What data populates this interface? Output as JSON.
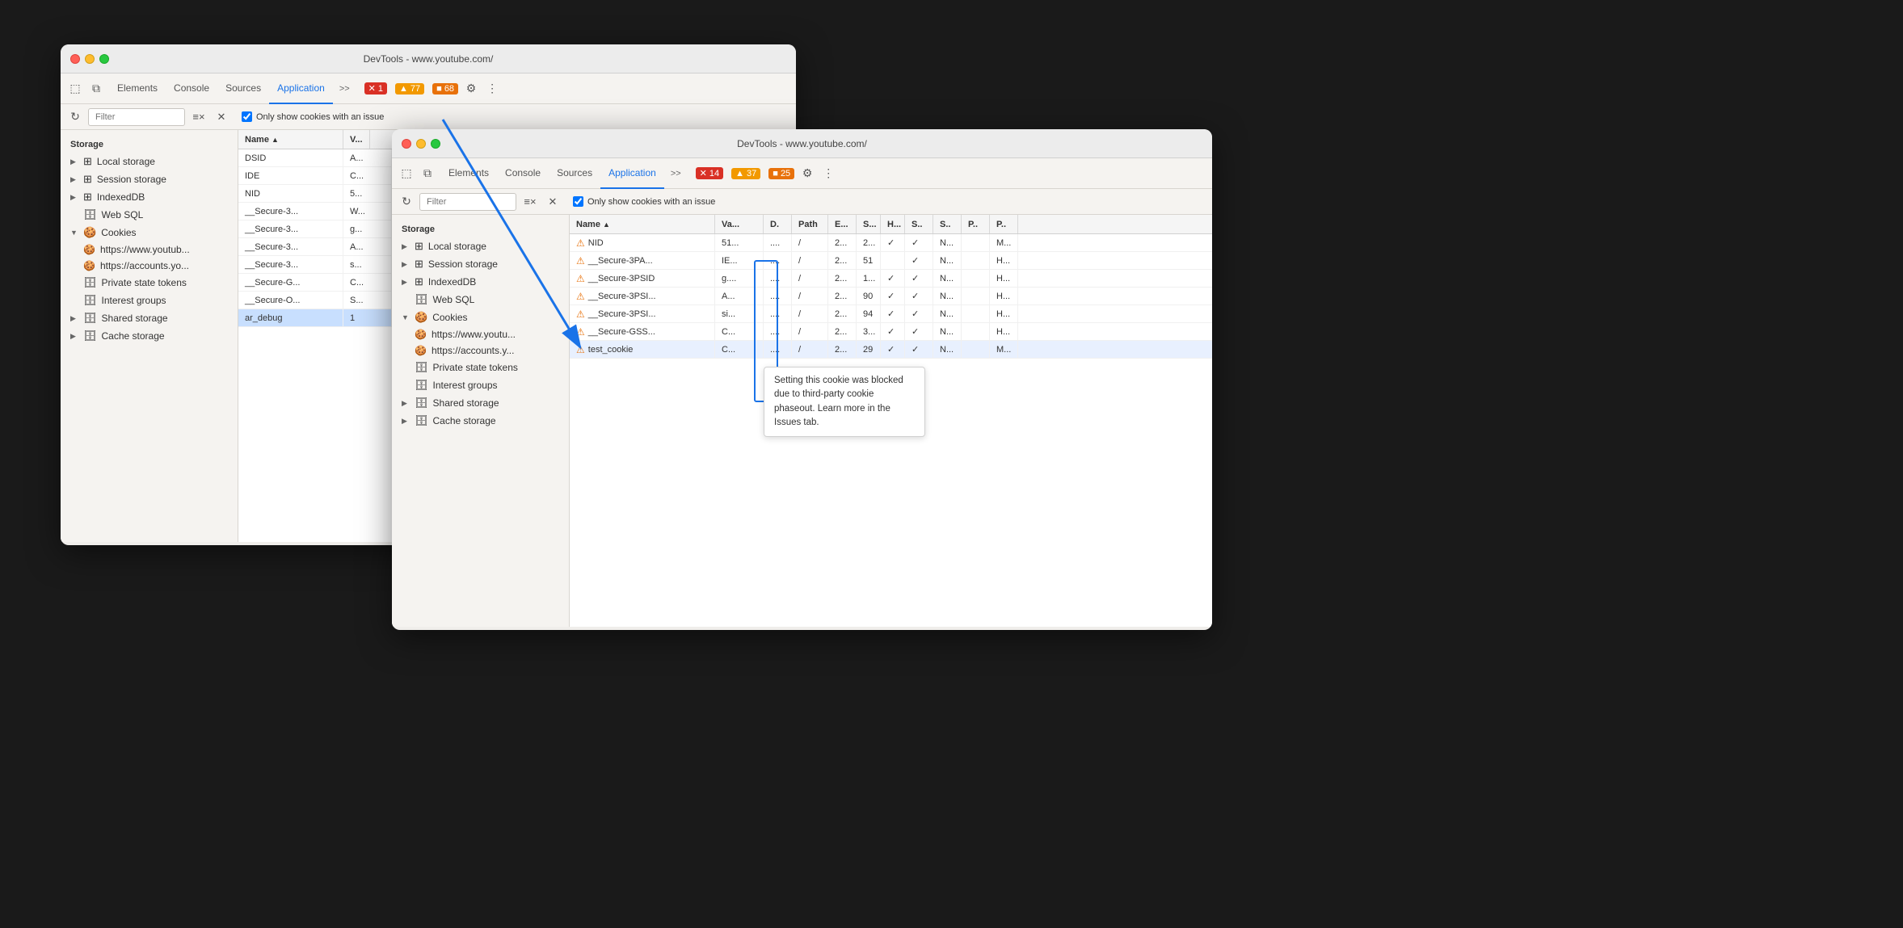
{
  "window_back": {
    "title": "DevTools - www.youtube.com/",
    "tabs": [
      "Elements",
      "Console",
      "Sources",
      "Application"
    ],
    "active_tab": "Application",
    "badges": [
      {
        "type": "error",
        "icon": "✕",
        "count": "1"
      },
      {
        "type": "warn",
        "icon": "▲",
        "count": "77"
      },
      {
        "type": "info",
        "icon": "■",
        "count": "68"
      }
    ],
    "filter_placeholder": "Filter",
    "filter_btn": "≡×",
    "checkbox_label": "Only show cookies with an issue",
    "sidebar": {
      "section": "Storage",
      "items": [
        {
          "label": "Local storage",
          "icon": "⊞",
          "arrow": "▶",
          "indent": 0
        },
        {
          "label": "Session storage",
          "icon": "⊞",
          "arrow": "▶",
          "indent": 0
        },
        {
          "label": "IndexedDB",
          "icon": "⊞",
          "arrow": "▶",
          "indent": 0
        },
        {
          "label": "Web SQL",
          "icon": "🗄",
          "arrow": "",
          "indent": 0
        },
        {
          "label": "Cookies",
          "icon": "🍪",
          "arrow": "▼",
          "indent": 0
        },
        {
          "label": "https://www.youtub...",
          "icon": "🍪",
          "arrow": "",
          "indent": 1
        },
        {
          "label": "https://accounts.yo...",
          "icon": "🍪",
          "arrow": "",
          "indent": 1
        },
        {
          "label": "Private state tokens",
          "icon": "🗄",
          "arrow": "",
          "indent": 0
        },
        {
          "label": "Interest groups",
          "icon": "🗄",
          "arrow": "",
          "indent": 0
        },
        {
          "label": "Shared storage",
          "icon": "🗄",
          "arrow": "▶",
          "indent": 0
        },
        {
          "label": "Cache storage",
          "icon": "🗄",
          "arrow": "▶",
          "indent": 0
        }
      ]
    },
    "table_headers": [
      "Name",
      "V..."
    ],
    "table_rows": [
      {
        "name": "DSID",
        "value": "A...",
        "selected": false
      },
      {
        "name": "IDE",
        "value": "C...",
        "selected": false
      },
      {
        "name": "NID",
        "value": "5...",
        "selected": false
      },
      {
        "name": "__Secure-3...",
        "value": "W...",
        "selected": false
      },
      {
        "name": "__Secure-3...",
        "value": "g...",
        "selected": false
      },
      {
        "name": "__Secure-3...",
        "value": "A...",
        "selected": false
      },
      {
        "name": "__Secure-3...",
        "value": "s...",
        "selected": false
      },
      {
        "name": "__Secure-G...",
        "value": "C...",
        "selected": false
      },
      {
        "name": "__Secure-O...",
        "value": "S...",
        "selected": false
      },
      {
        "name": "ar_debug",
        "value": "1",
        "selected": true
      }
    ]
  },
  "window_front": {
    "title": "DevTools - www.youtube.com/",
    "tabs": [
      "Elements",
      "Console",
      "Sources",
      "Application"
    ],
    "active_tab": "Application",
    "badges": [
      {
        "type": "error",
        "icon": "✕",
        "count": "14"
      },
      {
        "type": "warn",
        "icon": "▲",
        "count": "37"
      },
      {
        "type": "info",
        "icon": "■",
        "count": "25"
      }
    ],
    "filter_placeholder": "Filter",
    "checkbox_label": "Only show cookies with an issue",
    "sidebar": {
      "section": "Storage",
      "items": [
        {
          "label": "Local storage",
          "icon": "⊞",
          "arrow": "▶",
          "indent": 0
        },
        {
          "label": "Session storage",
          "icon": "⊞",
          "arrow": "▶",
          "indent": 0
        },
        {
          "label": "IndexedDB",
          "icon": "⊞",
          "arrow": "▶",
          "indent": 0
        },
        {
          "label": "Web SQL",
          "icon": "🗄",
          "arrow": "",
          "indent": 0
        },
        {
          "label": "Cookies",
          "icon": "🍪",
          "arrow": "▼",
          "indent": 0
        },
        {
          "label": "https://www.youtu...",
          "icon": "🍪",
          "arrow": "",
          "indent": 1
        },
        {
          "label": "https://accounts.y...",
          "icon": "🍪",
          "arrow": "",
          "indent": 1
        },
        {
          "label": "Private state tokens",
          "icon": "🗄",
          "arrow": "",
          "indent": 0
        },
        {
          "label": "Interest groups",
          "icon": "🗄",
          "arrow": "",
          "indent": 0
        },
        {
          "label": "Shared storage",
          "icon": "🗄",
          "arrow": "▶",
          "indent": 0
        },
        {
          "label": "Cache storage",
          "icon": "🗄",
          "arrow": "▶",
          "indent": 0
        }
      ]
    },
    "table_headers": [
      "Name",
      "Va...",
      "D.",
      "Path",
      "E...",
      "S...",
      "H...",
      "S..",
      "S..",
      "P..",
      "P.."
    ],
    "table_rows": [
      {
        "name": "NID",
        "value": "51...",
        "d": "....",
        "path": "/",
        "e": "2...",
        "s": "2...",
        "h": "✓",
        "s2": "✓",
        "s3": "N...",
        "p": "",
        "p2": "M...",
        "warn": true,
        "selected": false
      },
      {
        "name": "__Secure-3PA...",
        "value": "IE...",
        "d": "....",
        "path": "/",
        "e": "2...",
        "s": "51",
        "h": "",
        "s2": "✓",
        "s3": "N...",
        "p": "",
        "p2": "H...",
        "warn": true,
        "selected": false
      },
      {
        "name": "__Secure-3PSID",
        "value": "g....",
        "d": "....",
        "path": "/",
        "e": "2...",
        "s": "1...",
        "h": "✓",
        "s2": "✓",
        "s3": "N...",
        "p": "",
        "p2": "H...",
        "warn": true,
        "selected": false
      },
      {
        "name": "__Secure-3PSI...",
        "value": "A...",
        "d": "....",
        "path": "/",
        "e": "2...",
        "s": "90",
        "h": "✓",
        "s2": "✓",
        "s3": "N...",
        "p": "",
        "p2": "H...",
        "warn": true,
        "selected": false
      },
      {
        "name": "__Secure-3PSI...",
        "value": "si...",
        "d": "....",
        "path": "/",
        "e": "2...",
        "s": "94",
        "h": "✓",
        "s2": "✓",
        "s3": "N...",
        "p": "",
        "p2": "H...",
        "warn": true,
        "selected": false
      },
      {
        "name": "__Secure-GSS...",
        "value": "C...",
        "d": "....",
        "path": "/",
        "e": "2...",
        "s": "3...",
        "h": "✓",
        "s2": "✓",
        "s3": "N...",
        "p": "",
        "p2": "H...",
        "warn": true,
        "selected": false
      },
      {
        "name": "test_cookie",
        "value": "C...",
        "d": "....",
        "path": "/",
        "e": "2...",
        "s": "29",
        "h": "✓",
        "s2": "✓",
        "s3": "N...",
        "p": "",
        "p2": "M...",
        "warn": true,
        "selected": true,
        "highlighted": true
      }
    ],
    "tooltip": "Setting this cookie was blocked due to third-party cookie phaseout. Learn more in the Issues tab."
  },
  "annotation": {
    "arrow_start": "Application tab in back window",
    "arrow_end": "warning icons in front window"
  }
}
